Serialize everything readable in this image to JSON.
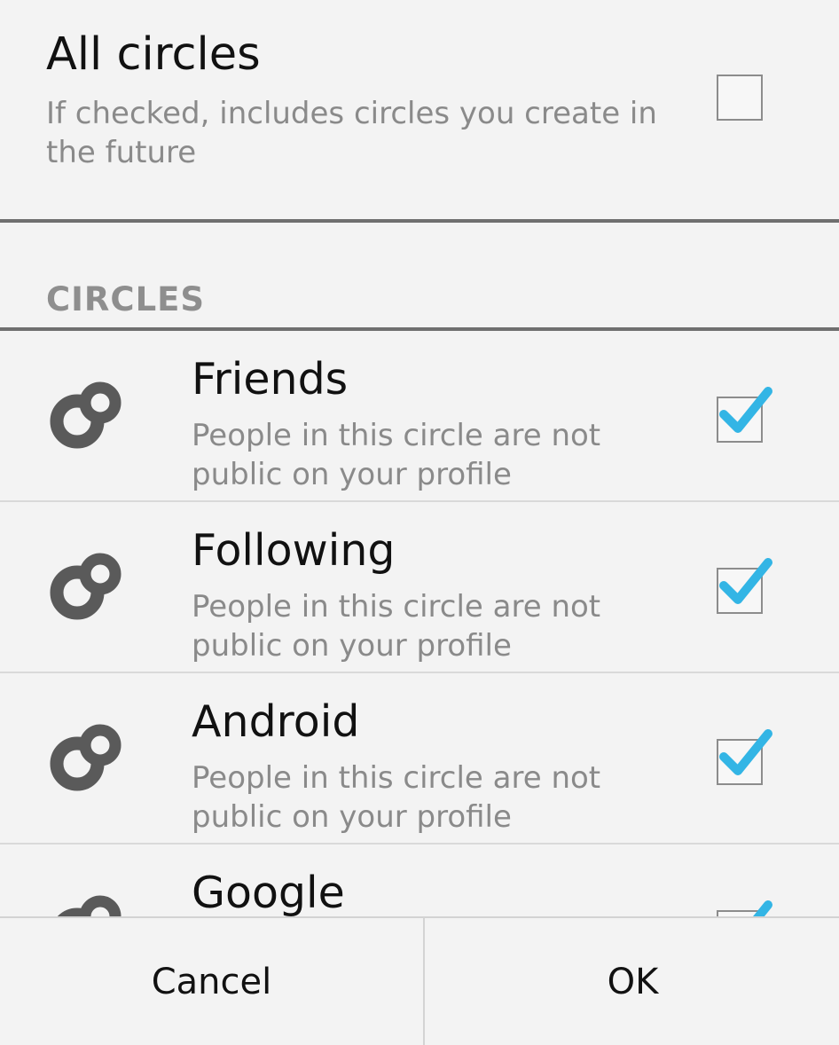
{
  "all_circles": {
    "title": "All circles",
    "description": "If checked, includes circles you create in the future",
    "checked": false
  },
  "section": {
    "header": "CIRCLES"
  },
  "circles": [
    {
      "name": "Friends",
      "description": "People in this circle are not public on your profile",
      "checked": true,
      "icon": "circles-icon"
    },
    {
      "name": "Following",
      "description": "People in this circle are not public on your profile",
      "checked": true,
      "icon": "circles-icon"
    },
    {
      "name": "Android",
      "description": "People in this circle are not public on your profile",
      "checked": true,
      "icon": "circles-icon"
    },
    {
      "name": "Google",
      "description": "",
      "checked": true,
      "icon": "circles-icon"
    }
  ],
  "buttons": {
    "cancel": "Cancel",
    "ok": "OK"
  },
  "colors": {
    "accent": "#33b5e5",
    "text": "#111111",
    "secondary_text": "#8a8a8a",
    "icon": "#5a5a5a"
  }
}
